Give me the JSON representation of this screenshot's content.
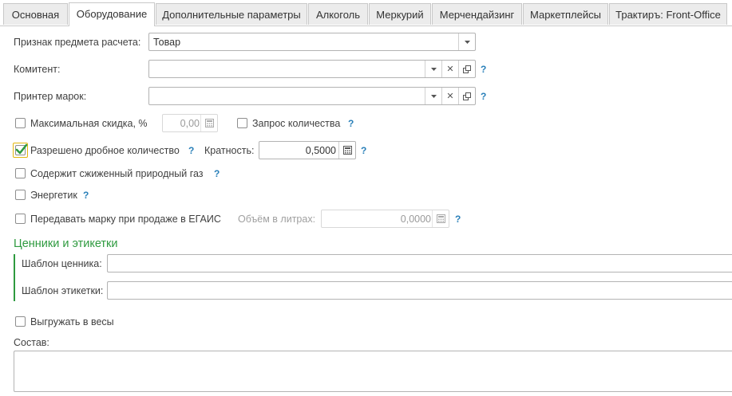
{
  "tabs": [
    {
      "label": "Основная",
      "active": false
    },
    {
      "label": "Оборудование",
      "active": true
    },
    {
      "label": "Дополнительные параметры",
      "active": false
    },
    {
      "label": "Алкоголь",
      "active": false
    },
    {
      "label": "Меркурий",
      "active": false
    },
    {
      "label": "Мерчендайзинг",
      "active": false
    },
    {
      "label": "Маркетплейсы",
      "active": false
    },
    {
      "label": "Трактиръ: Front-Office",
      "active": false
    }
  ],
  "form": {
    "payment_subject": {
      "label": "Признак предмета расчета:",
      "value": "Товар"
    },
    "consignor": {
      "label": "Комитент:",
      "value": ""
    },
    "label_printer": {
      "label": "Принтер марок:",
      "value": ""
    },
    "max_discount": {
      "label": "Максимальная скидка, %",
      "value": "0,00",
      "checked": false
    },
    "quantity_request": {
      "label": "Запрос количества",
      "checked": false
    },
    "fractional_qty": {
      "label": "Разрешено дробное количество",
      "checked": true
    },
    "multiplicity": {
      "label": "Кратность:",
      "value": "0,5000"
    },
    "liquefied_gas": {
      "label": "Содержит сжиженный природный газ",
      "checked": false
    },
    "energy_drink": {
      "label": "Энергетик",
      "checked": false
    },
    "egais_mark": {
      "label": "Передавать марку при продаже в ЕГАИС",
      "checked": false
    },
    "volume_liters": {
      "label": "Объём в литрах:",
      "value": "0,0000"
    },
    "price_tags_group": {
      "title": "Ценники и этикетки"
    },
    "price_tag_template": {
      "label": "Шаблон ценника:",
      "value": ""
    },
    "label_template": {
      "label": "Шаблон этикетки:",
      "value": ""
    },
    "weight_export": {
      "label": "Выгружать в весы",
      "checked": false
    },
    "composition": {
      "label": "Состав:",
      "value": ""
    }
  },
  "help_mark": "?",
  "colors": {
    "accent_green": "#2e9a3f",
    "help_blue": "#2a80b9",
    "focus_yellow": "#e3b60d"
  }
}
